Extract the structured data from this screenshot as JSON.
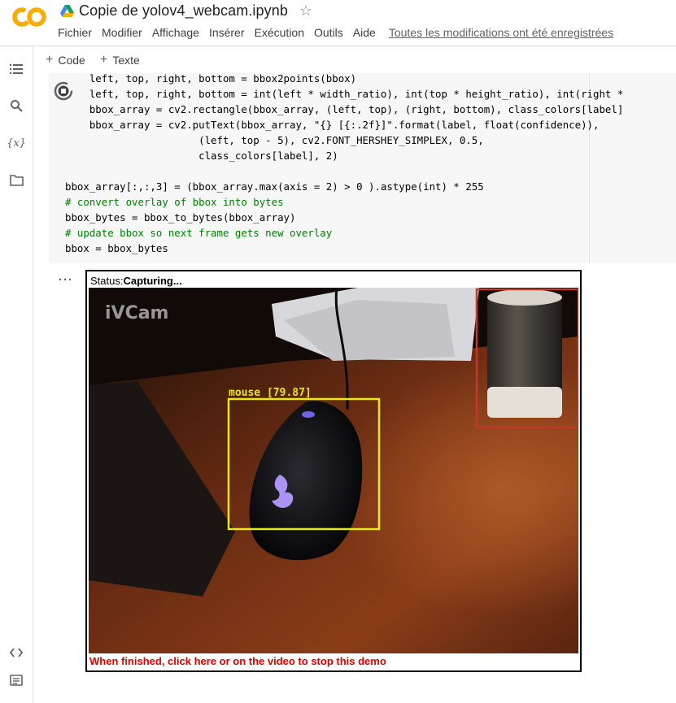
{
  "header": {
    "logo_text": "CO",
    "notebook_title": "Copie de yolov4_webcam.ipynb",
    "menu": [
      "Fichier",
      "Modifier",
      "Affichage",
      "Insérer",
      "Exécution",
      "Outils",
      "Aide"
    ],
    "save_status": "Toutes les modifications ont été enregistrées"
  },
  "sidebar": {
    "icons": [
      "table-of-contents-icon",
      "search-icon",
      "variables-icon",
      "files-icon",
      "code-snippets-icon",
      "terminal-icon"
    ],
    "variables_label": "{x}"
  },
  "toolbar": {
    "add_code_label": "Code",
    "add_text_label": "Texte"
  },
  "cell": {
    "lines": [
      "    left, top, right, bottom = bbox2points(bbox)",
      "    left, top, right, bottom = int(left * width_ratio), int(top * height_ratio), int(right *",
      "    bbox_array = cv2.rectangle(bbox_array, (left, top), (right, bottom), class_colors[label]",
      "    bbox_array = cv2.putText(bbox_array, \"{} [{:.2f}]\".format(label, float(confidence)),",
      "                      (left, top - 5), cv2.FONT_HERSHEY_SIMPLEX, 0.5,",
      "                      class_colors[label], 2)",
      "",
      "bbox_array[:,:,3] = (bbox_array.max(axis = 2) > 0 ).astype(int) * 255",
      "# convert overlay of bbox into bytes",
      "bbox_bytes = bbox_to_bytes(bbox_array)",
      "# update bbox so next frame gets new overlay",
      "bbox = bbox_bytes"
    ]
  },
  "output": {
    "status_label": "Status:",
    "status_value": "Capturing...",
    "watermark": "iVCam",
    "detection_label": "mouse [79.87]",
    "stop_message": "When finished, click here or on the video to stop this demo"
  },
  "colors": {
    "logo_orange": "#f9ab00",
    "detection_yellow": "#e8e820",
    "detection_red": "#c0392b",
    "stop_message_red": "#e00000"
  }
}
